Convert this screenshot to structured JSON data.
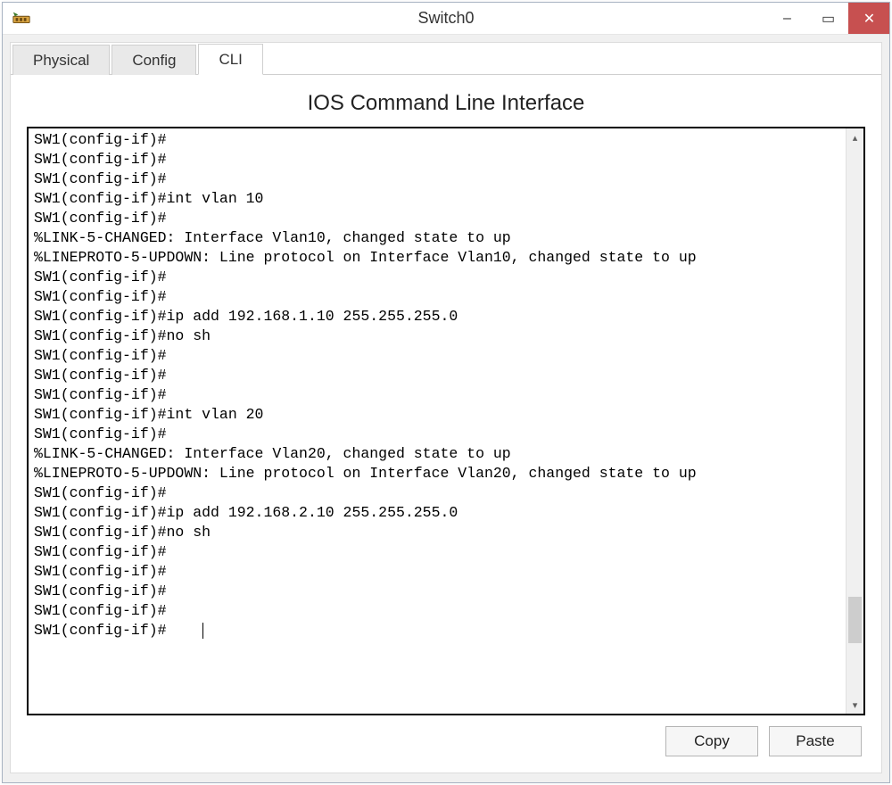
{
  "window": {
    "title": "Switch0",
    "controls": {
      "minimize_glyph": "–",
      "maximize_glyph": "▭",
      "close_glyph": "✕"
    }
  },
  "tabs": [
    {
      "label": "Physical",
      "active": false
    },
    {
      "label": "Config",
      "active": false
    },
    {
      "label": "CLI",
      "active": true
    }
  ],
  "panel": {
    "title": "IOS Command Line Interface"
  },
  "terminal": {
    "lines": [
      "SW1(config-if)#",
      "SW1(config-if)#",
      "SW1(config-if)#",
      "SW1(config-if)#int vlan 10",
      "SW1(config-if)#",
      "%LINK-5-CHANGED: Interface Vlan10, changed state to up",
      "",
      "%LINEPROTO-5-UPDOWN: Line protocol on Interface Vlan10, changed state to up",
      "",
      "SW1(config-if)#",
      "SW1(config-if)#",
      "SW1(config-if)#ip add 192.168.1.10 255.255.255.0",
      "SW1(config-if)#no sh",
      "SW1(config-if)#",
      "SW1(config-if)#",
      "SW1(config-if)#",
      "SW1(config-if)#int vlan 20",
      "SW1(config-if)#",
      "%LINK-5-CHANGED: Interface Vlan20, changed state to up",
      "",
      "%LINEPROTO-5-UPDOWN: Line protocol on Interface Vlan20, changed state to up",
      "",
      "SW1(config-if)#",
      "SW1(config-if)#ip add 192.168.2.10 255.255.255.0",
      "SW1(config-if)#no sh",
      "SW1(config-if)#",
      "SW1(config-if)#",
      "SW1(config-if)#",
      "SW1(config-if)#",
      "SW1(config-if)#"
    ],
    "scroll": {
      "up_glyph": "▴",
      "down_glyph": "▾",
      "thumb_top_pct": 80,
      "thumb_height_pct": 8
    }
  },
  "buttons": {
    "copy": "Copy",
    "paste": "Paste"
  }
}
